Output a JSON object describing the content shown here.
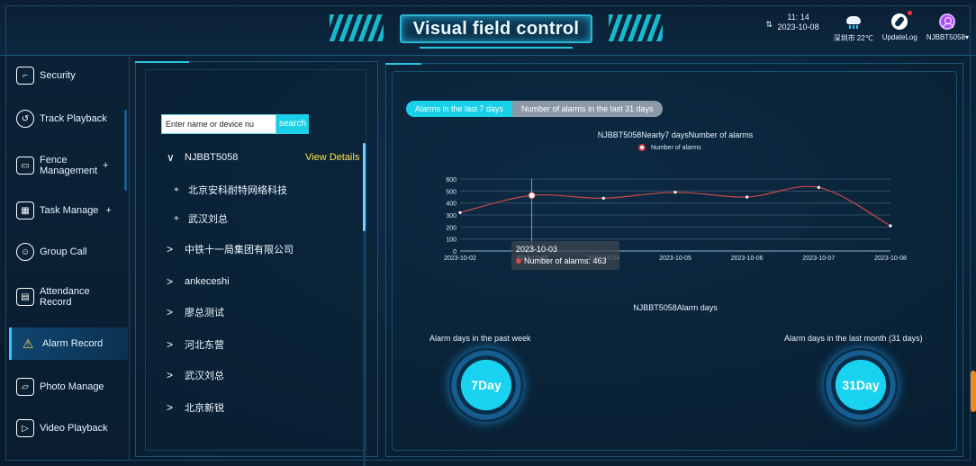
{
  "header": {
    "title": "Visual field control",
    "clock_time": "11: 14",
    "clock_date": "2023-10-08",
    "weather": "深圳市 22℃",
    "update_log": "UpdateLog",
    "user": "NJBBT5058▾"
  },
  "sidebar": {
    "items": [
      {
        "label": "Security",
        "icon": "security-icon"
      },
      {
        "label": "Track Playback",
        "icon": "track-playback-icon"
      },
      {
        "label": "Fence Management",
        "icon": "fence-icon",
        "plus": "+"
      },
      {
        "label": "Task Manage",
        "icon": "task-icon",
        "plus": "+"
      },
      {
        "label": "Group Call",
        "icon": "group-call-icon"
      },
      {
        "label": "Attendance Record",
        "icon": "attendance-icon"
      },
      {
        "label": "Alarm Record",
        "icon": "alarm-icon",
        "active": true
      },
      {
        "label": "Photo Manage",
        "icon": "photo-icon"
      },
      {
        "label": "Video Playback",
        "icon": "video-icon"
      }
    ]
  },
  "tree": {
    "search_placeholder": "Enter name or device nu",
    "search_button": "search",
    "view_details": "View Details",
    "nodes": [
      {
        "caret": "∨",
        "label": "NJBBT5058"
      },
      {
        "caret": "+",
        "label": "北京安科耐特网络科技"
      },
      {
        "caret": "+",
        "label": "武汉刘总"
      },
      {
        "caret": ">",
        "label": "中铁十一局集团有限公司"
      },
      {
        "caret": ">",
        "label": "ankeceshi"
      },
      {
        "caret": ">",
        "label": "廖总测试"
      },
      {
        "caret": ">",
        "label": "河北东营"
      },
      {
        "caret": ">",
        "label": "武汉刘总"
      },
      {
        "caret": ">",
        "label": "北京新锐"
      }
    ]
  },
  "main": {
    "tab_active": "Alarms in the last 7 days",
    "tab_inactive": "Number of alarms in the last 31 days",
    "chart_title": "NJBBT5058Nearly7 daysNumber of alarms",
    "legend": "Number of alarms",
    "tooltip_date": "2023-10-03",
    "tooltip_value": "Number of alarms: 463",
    "alarm_days_title": "NJBBT5058Alarm days",
    "week_label": "Alarm days in the past week",
    "month_label": "Alarm days in the last month (31 days)",
    "week_value": "7Day",
    "month_value": "31Day"
  },
  "chart_data": {
    "type": "line",
    "title": "NJBBT5058Nearly7 daysNumber of alarms",
    "categories": [
      "2023-10-02",
      "2023-10-03",
      "2023-10-04",
      "2023-10-05",
      "2023-10-06",
      "2023-10-07",
      "2023-10-08"
    ],
    "series": [
      {
        "name": "Number of alarms",
        "values": [
          320,
          463,
          440,
          490,
          450,
          530,
          210
        ]
      }
    ],
    "yticks": [
      0,
      100,
      200,
      300,
      400,
      500,
      600
    ],
    "ylim": [
      0,
      600
    ],
    "legend_position": "top-center",
    "grid": true,
    "line_color": "#c74a4a"
  }
}
